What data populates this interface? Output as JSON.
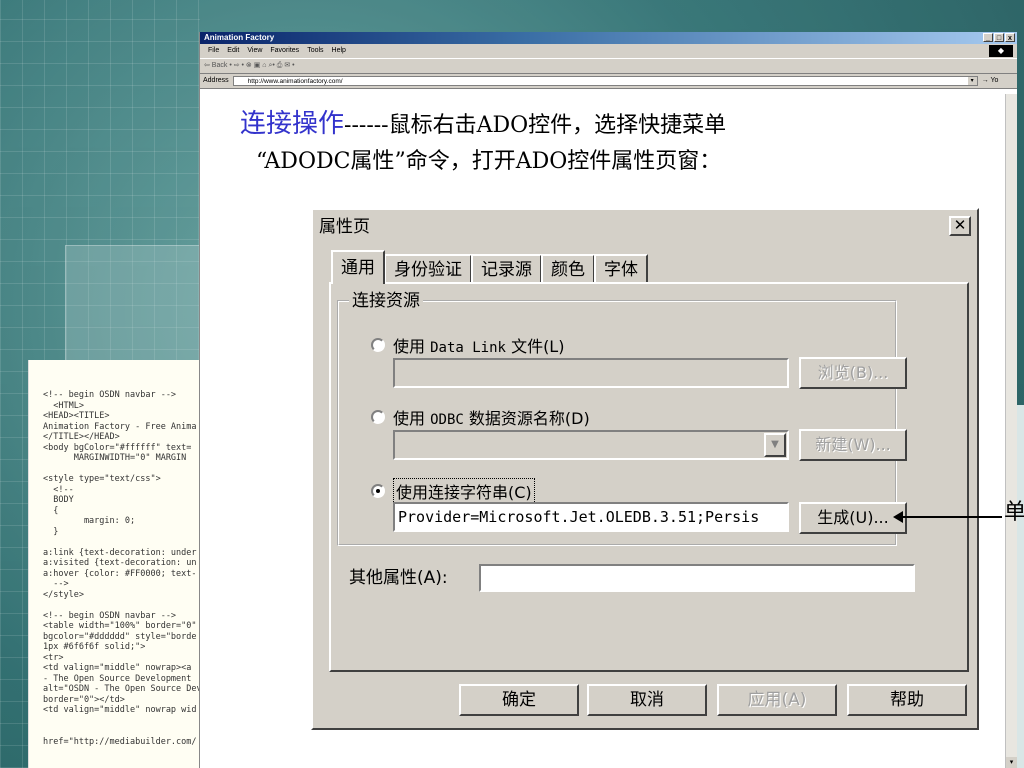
{
  "background": {
    "code_lines": [
      "<!-- begin OSDN navbar -->",
      "  <HTML>",
      "<HEAD><TITLE>",
      "Animation Factory - Free Anima",
      "</TITLE></HEAD>",
      "<body bgColor=\"#ffffff\" text=",
      "      MARGINWIDTH=\"0\" MARGIN",
      "",
      "<style type=\"text/css\">",
      "  <!--",
      "  BODY",
      "  {",
      "        margin: 0;",
      "  }",
      "",
      "a:link {text-decoration: under",
      "a:visited {text-decoration: un",
      "a:hover {color: #FF0000; text-",
      "  -->",
      "</style>",
      "",
      "<!-- begin OSDN navbar -->",
      "<table width=\"100%\" border=\"0\"",
      "bgcolor=\"#dddddd\" style=\"borde",
      "1px #6f6f6f solid;\">",
      "<tr>",
      "<td valign=\"middle\" nowrap><a",
      "- The Open Source Development",
      "alt=\"OSDN - The Open Source Dev",
      "border=\"0\"></td>",
      "<td valign=\"middle\" nowrap wid",
      "",
      "",
      "href=\"http://mediabuilder.com/"
    ]
  },
  "browser": {
    "title": "Animation Factory",
    "menu": [
      "File",
      "Edit",
      "View",
      "Favorites",
      "Tools",
      "Help"
    ],
    "toolbar_text": "⇦ Back • ⇨ • ⊗ ▣ ⌂  ⌕• ⎙ ✉ •",
    "address_label": "Address",
    "address_value": "http://www.animationfactory.com/",
    "go_label": "→ Yo",
    "window_buttons": [
      "_",
      "□",
      "x"
    ]
  },
  "slide": {
    "heading_highlight": "连接操作",
    "heading_rest": "------鼠标右击ADO控件，选择快捷菜单",
    "heading_line2": "“ADODC属性”命令，打开ADO控件属性页窗："
  },
  "dialog": {
    "title": "属性页",
    "close_label": "✕",
    "tabs": [
      "通用",
      "身份验证",
      "记录源",
      "颜色",
      "字体"
    ],
    "group_label": "连接资源",
    "options": [
      {
        "prefix": "使用",
        "mono": "Data Link",
        "suffix": "文件(L)",
        "selected": false
      },
      {
        "prefix": "使用",
        "mono": "ODBC",
        "suffix": "数据资源名称(D)",
        "selected": false
      },
      {
        "prefix": "使用连接字符串(C)",
        "mono": "",
        "suffix": "",
        "selected": true
      }
    ],
    "browse_button": "浏览(B)...",
    "new_button": "新建(W)...",
    "build_button": "生成(U)...",
    "datalink_value": "",
    "odbc_value": "",
    "connection_string": "Provider=Microsoft.Jet.OLEDB.3.51;Persis",
    "other_props_label": "其他属性(A):",
    "other_props_value": "",
    "ok_button": "确定",
    "cancel_button": "取消",
    "apply_button": "应用(A)",
    "help_button": "帮助"
  },
  "callout": {
    "text": "单"
  }
}
